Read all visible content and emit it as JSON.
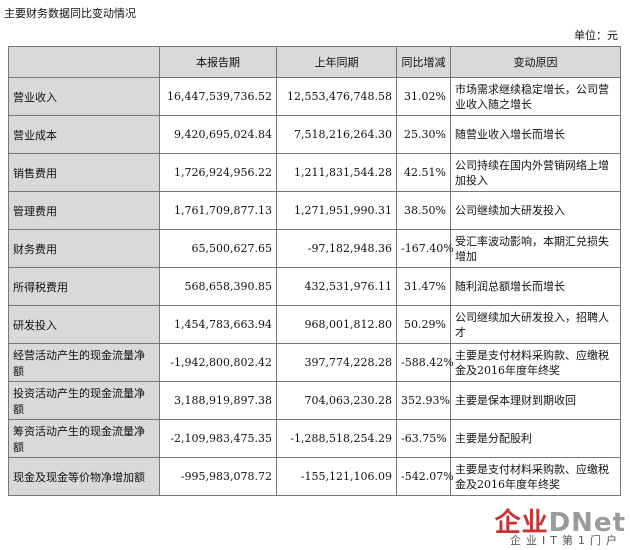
{
  "title": "主要财务数据同比变动情况",
  "unit": "单位：元",
  "table": {
    "headers": [
      "",
      "本报告期",
      "上年同期",
      "同比增减",
      "变动原因"
    ],
    "rows": [
      {
        "label": "营业收入",
        "current": "16,447,539,736.52",
        "previous": "12,553,476,748.58",
        "change": "31.02%",
        "reason": "市场需求继续稳定增长，公司营业收入随之增长"
      },
      {
        "label": "营业成本",
        "current": "9,420,695,024.84",
        "previous": "7,518,216,264.30",
        "change": "25.30%",
        "reason": "随营业收入增长而增长"
      },
      {
        "label": "销售费用",
        "current": "1,726,924,956.22",
        "previous": "1,211,831,544.28",
        "change": "42.51%",
        "reason": "公司持续在国内外营销网络上增加投入"
      },
      {
        "label": "管理费用",
        "current": "1,761,709,877.13",
        "previous": "1,271,951,990.31",
        "change": "38.50%",
        "reason": "公司继续加大研发投入"
      },
      {
        "label": "财务费用",
        "current": "65,500,627.65",
        "previous": "-97,182,948.36",
        "change": "-167.40%",
        "reason": "受汇率波动影响，本期汇兑损失增加"
      },
      {
        "label": "所得税费用",
        "current": "568,658,390.85",
        "previous": "432,531,976.11",
        "change": "31.47%",
        "reason": "随利润总额增长而增长"
      },
      {
        "label": "研发投入",
        "current": "1,454,783,663.94",
        "previous": "968,001,812.80",
        "change": "50.29%",
        "reason": "公司继续加大研发投入，招聘人才"
      },
      {
        "label": "经营活动产生的现金流量净额",
        "current": "-1,942,800,802.42",
        "previous": "397,774,228.28",
        "change": "-588.42%",
        "reason": "主要是支付材料采购款、应缴税金及2016年度年终奖"
      },
      {
        "label": "投资活动产生的现金流量净额",
        "current": "3,188,919,897.38",
        "previous": "704,063,230.28",
        "change": "352.93%",
        "reason": "主要是保本理财到期收回"
      },
      {
        "label": "筹资活动产生的现金流量净额",
        "current": "-2,109,983,475.35",
        "previous": "-1,288,518,254.29",
        "change": "-63.75%",
        "reason": "主要是分配股利"
      },
      {
        "label": "现金及现金等价物净增加额",
        "current": "-995,983,078.72",
        "previous": "-155,121,106.09",
        "change": "-542.07%",
        "reason": "主要是支付材料采购款、应缴税金及2016年度年终奖"
      }
    ]
  },
  "watermark": {
    "logo_part1": "企业",
    "logo_part2": "DNet",
    "subtitle": "企业IT第1门户"
  }
}
